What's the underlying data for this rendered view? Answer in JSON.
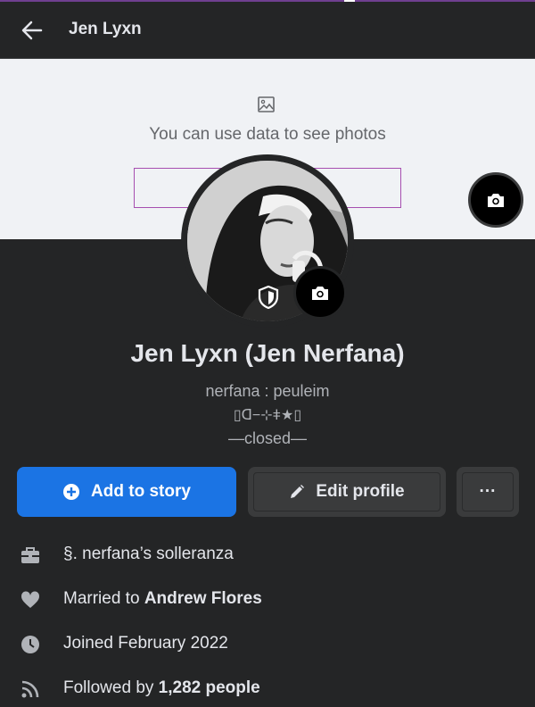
{
  "appbar": {
    "title": "Jen Lyxn"
  },
  "cover": {
    "placeholder_text": "You can use data to see photos"
  },
  "profile": {
    "name": "Jen Lyxn (Jen Nerfana)",
    "bio_line1": "nerfana : peuleim",
    "bio_line2": "▯ᗡ−⊹ǂ★▯",
    "bio_line3": "—closed—"
  },
  "actions": {
    "add_story": "Add to story",
    "edit_profile": "Edit profile",
    "more": "···"
  },
  "info": {
    "work": "§. nerfana’s solleranza",
    "married_prefix": "Married to ",
    "married_name": "Andrew Flores",
    "joined": "Joined February 2022",
    "followed_prefix": "Followed by ",
    "followed_count": "1,282 people"
  },
  "icons": {
    "back": "arrow-left-icon",
    "cover_image": "image-icon",
    "camera": "camera-icon",
    "shield": "shield-icon",
    "add": "plus-circle-icon",
    "edit": "pencil-icon",
    "work": "briefcase-icon",
    "relationship": "heart-icon",
    "joined": "clock-icon",
    "followers": "rss-icon"
  },
  "colors": {
    "accent": "#1b74e4",
    "background": "#242526",
    "cover": "#f0f2f5"
  }
}
